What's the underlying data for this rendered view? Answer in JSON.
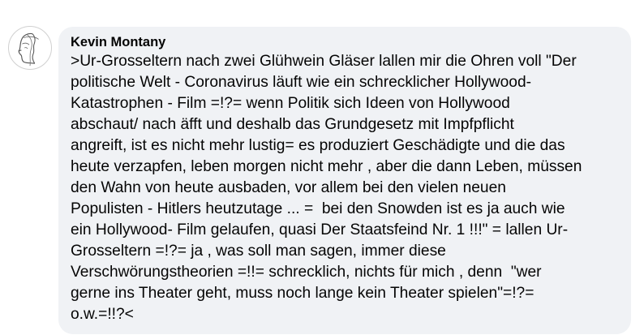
{
  "comment": {
    "author": "Kevin Montany",
    "lines": [
      ">Ur-Grosseltern nach zwei Glühwein Gläser lallen mir die Ohren voll \"Der",
      "politische Welt - Coronavirus läuft wie ein schrecklicher Hollywood-",
      "Katastrophen - Film =!?= wenn Politik sich Ideen von Hollywood",
      "abschaut/ nach äfft und deshalb das Grundgesetz mit Impfpflicht",
      "angreift, ist es nicht mehr lustig= es produziert Geschädigte und die das",
      "heute verzapfen, leben morgen nicht mehr , aber die dann Leben, müssen",
      "den Wahn von heute ausbaden, vor allem bei den vielen neuen",
      "Populisten - Hitlers heutzutage ... =  bei den Snowden ist es ja auch wie",
      "ein Hollywood- Film gelaufen, quasi Der Staatsfeind Nr. 1 !!!\" = lallen Ur-",
      "Grosseltern =!?= ja , was soll man sagen, immer diese",
      "Verschwörungstheorien =!!= schrecklich, nichts für mich , denn  \"wer",
      "gerne ins Theater geht, muss noch lange kein Theater spielen\"=!?=",
      "o.w.=!!?<"
    ],
    "avatar_icon": "sketched-face-avatar-icon"
  },
  "colors": {
    "bubble_background": "#f0f2f5",
    "text": "#050505",
    "page_background": "#ffffff"
  }
}
